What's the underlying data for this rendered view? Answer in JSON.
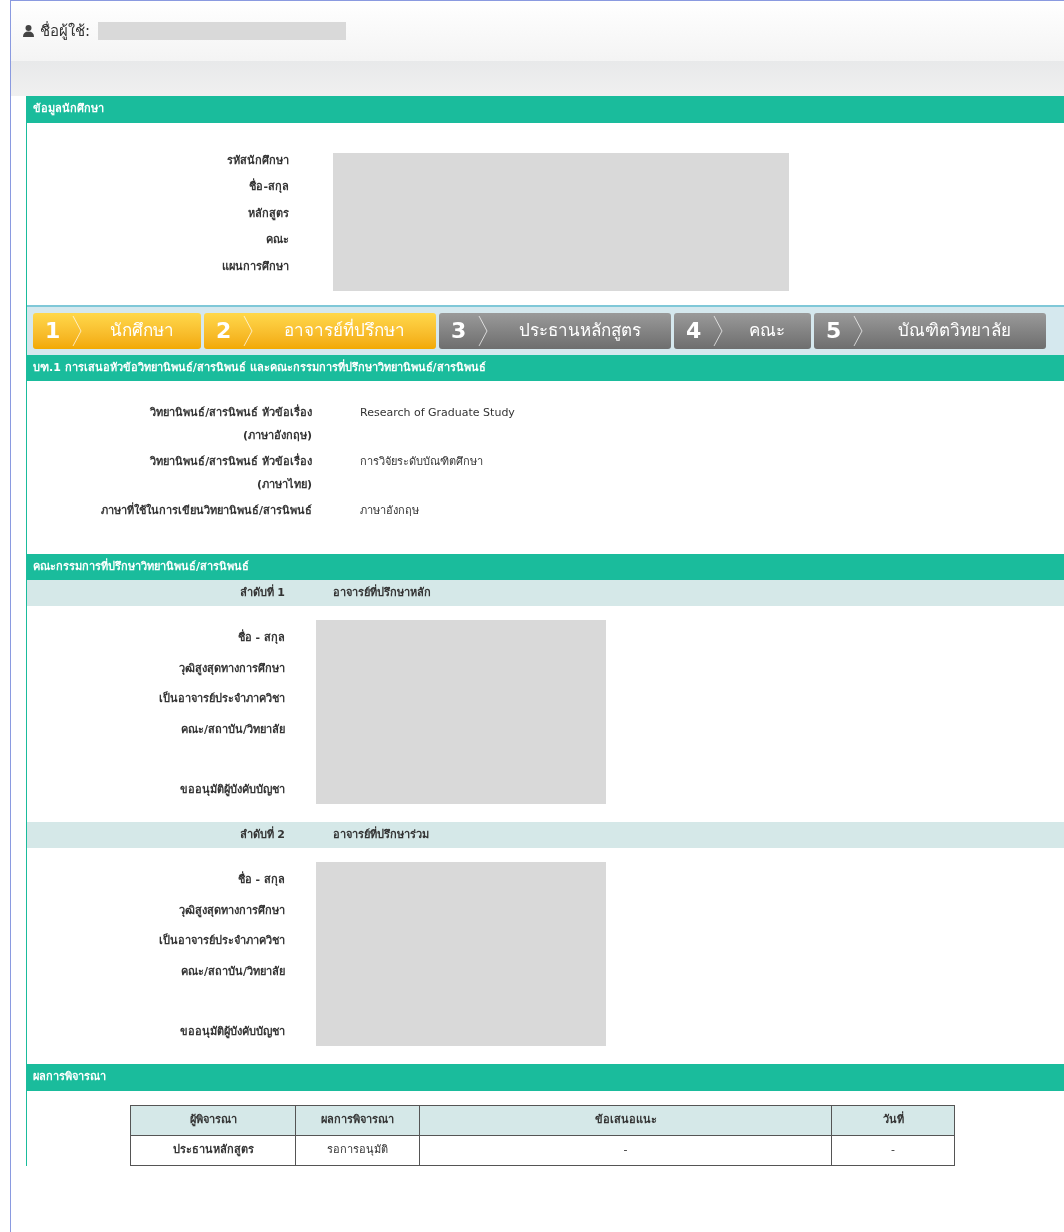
{
  "user_bar": {
    "label": "ชื่อผู้ใช้:"
  },
  "student_info": {
    "title": "ข้อมูลนักศึกษา",
    "fields": [
      "รหัสนักศึกษา",
      "ชื่อ-สกุล",
      "หลักสูตร",
      "คณะ",
      "แผนการศึกษา"
    ]
  },
  "steps": [
    {
      "number": "1",
      "label": "นักศึกษา",
      "reached": true
    },
    {
      "number": "2",
      "label": "อาจารย์ที่ปรึกษา",
      "reached": true
    },
    {
      "number": "3",
      "label": "ประธานหลักสูตร",
      "reached": false
    },
    {
      "number": "4",
      "label": "คณะ",
      "reached": false
    },
    {
      "number": "5",
      "label": "บัณฑิตวิทยาลัย",
      "reached": false
    }
  ],
  "proposal": {
    "title": "บฑ.1 การเสนอหัวข้อวิทยานิพนธ์/สารนิพนธ์ และคณะกรรมการที่ปรึกษาวิทยานิพนธ์/สารนิพนธ์",
    "rows": [
      {
        "label": "วิทยานิพนธ์/สารนิพนธ์ หัวข้อเรื่อง",
        "sublabel": "(ภาษาอังกฤษ)",
        "value": "Research of Graduate Study"
      },
      {
        "label": "วิทยานิพนธ์/สารนิพนธ์ หัวข้อเรื่อง",
        "sublabel": "(ภาษาไทย)",
        "value": "การวิจัยระดับบัณฑิตศึกษา"
      },
      {
        "label": "ภาษาที่ใช้ในการเขียนวิทยานิพนธ์/สารนิพนธ์",
        "value": "ภาษาอังกฤษ"
      }
    ]
  },
  "committee": {
    "title": "คณะกรรมการที่ปรึกษาวิทยานิพนธ์/สารนิพนธ์",
    "members": [
      {
        "order": "ลำดับที่ 1",
        "role": "อาจารย์ที่ปรึกษาหลัก",
        "fields": [
          "ชื่อ - สกุล",
          "วุฒิสูงสุดทางการศึกษา",
          "เป็นอาจารย์ประจำภาควิชา",
          "คณะ/สถาบัน/วิทยาลัย",
          "ขออนุมัติผู้บังคับบัญชา"
        ]
      },
      {
        "order": "ลำดับที่ 2",
        "role": "อาจารย์ที่ปรึกษาร่วม",
        "fields": [
          "ชื่อ - สกุล",
          "วุฒิสูงสุดทางการศึกษา",
          "เป็นอาจารย์ประจำภาควิชา",
          "คณะ/สถาบัน/วิทยาลัย",
          "ขออนุมัติผู้บังคับบัญชา"
        ]
      }
    ]
  },
  "result": {
    "title": "ผลการพิจารณา",
    "table": {
      "columns": [
        "ผู้พิจารณา",
        "ผลการพิจารณา",
        "ข้อเสนอแนะ",
        "วันที่"
      ],
      "rows": [
        [
          "ประธานหลักสูตร",
          "รอการอนุมัติ",
          "-",
          "-"
        ]
      ]
    }
  }
}
